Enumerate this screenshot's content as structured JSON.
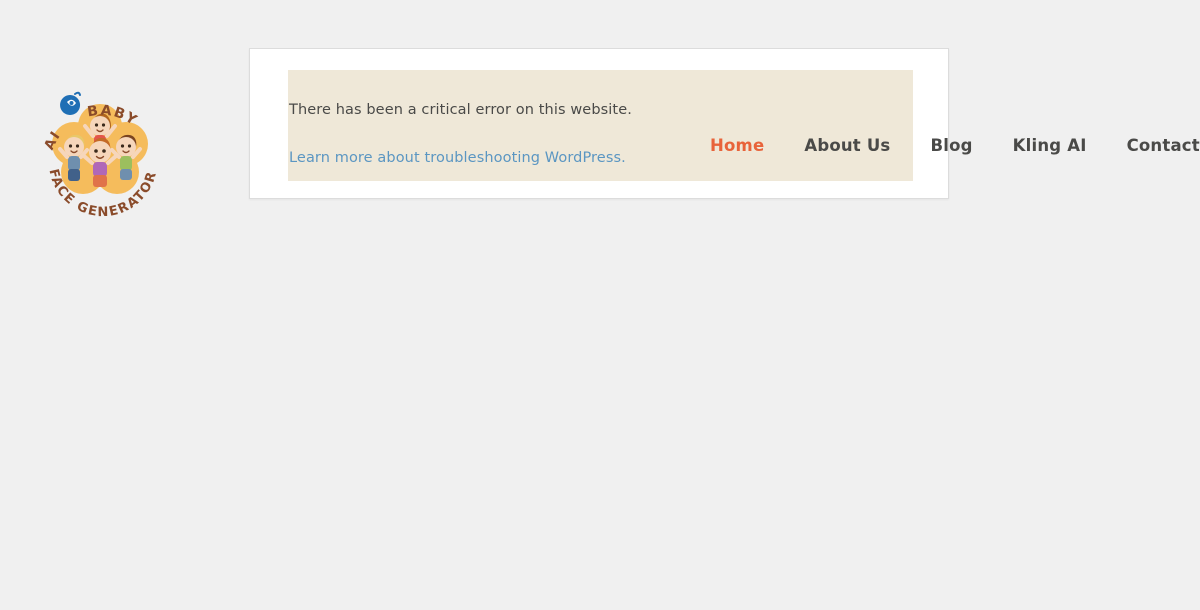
{
  "page": {
    "background_color": "#f0f0f0"
  },
  "logo": {
    "name": "ai-baby-face-generator-logo",
    "top_arc_text_1": "AI",
    "top_arc_text_2": "BABY",
    "bottom_arc_text": "FACE GENERATOR",
    "petal_color": "#f5bc5c",
    "text_color": "#8a4b2a",
    "icon_color": "#1f6fb5",
    "alt": "AI Baby Face Generator"
  },
  "error_card": {
    "panel_background": "#efe8d8",
    "message": "There has been a critical error on this website.",
    "link_text": "Learn more about troubleshooting WordPress.",
    "message_color": "#4a4a48",
    "link_color": "#5b96c2"
  },
  "nav": {
    "active_color": "#e8633a",
    "inactive_color": "#4a4a48",
    "items": [
      {
        "label": "Home",
        "active": true
      },
      {
        "label": "About Us",
        "active": false
      },
      {
        "label": "Blog",
        "active": false
      },
      {
        "label": "Kling AI",
        "active": false
      },
      {
        "label": "Contact",
        "active": false
      }
    ]
  }
}
